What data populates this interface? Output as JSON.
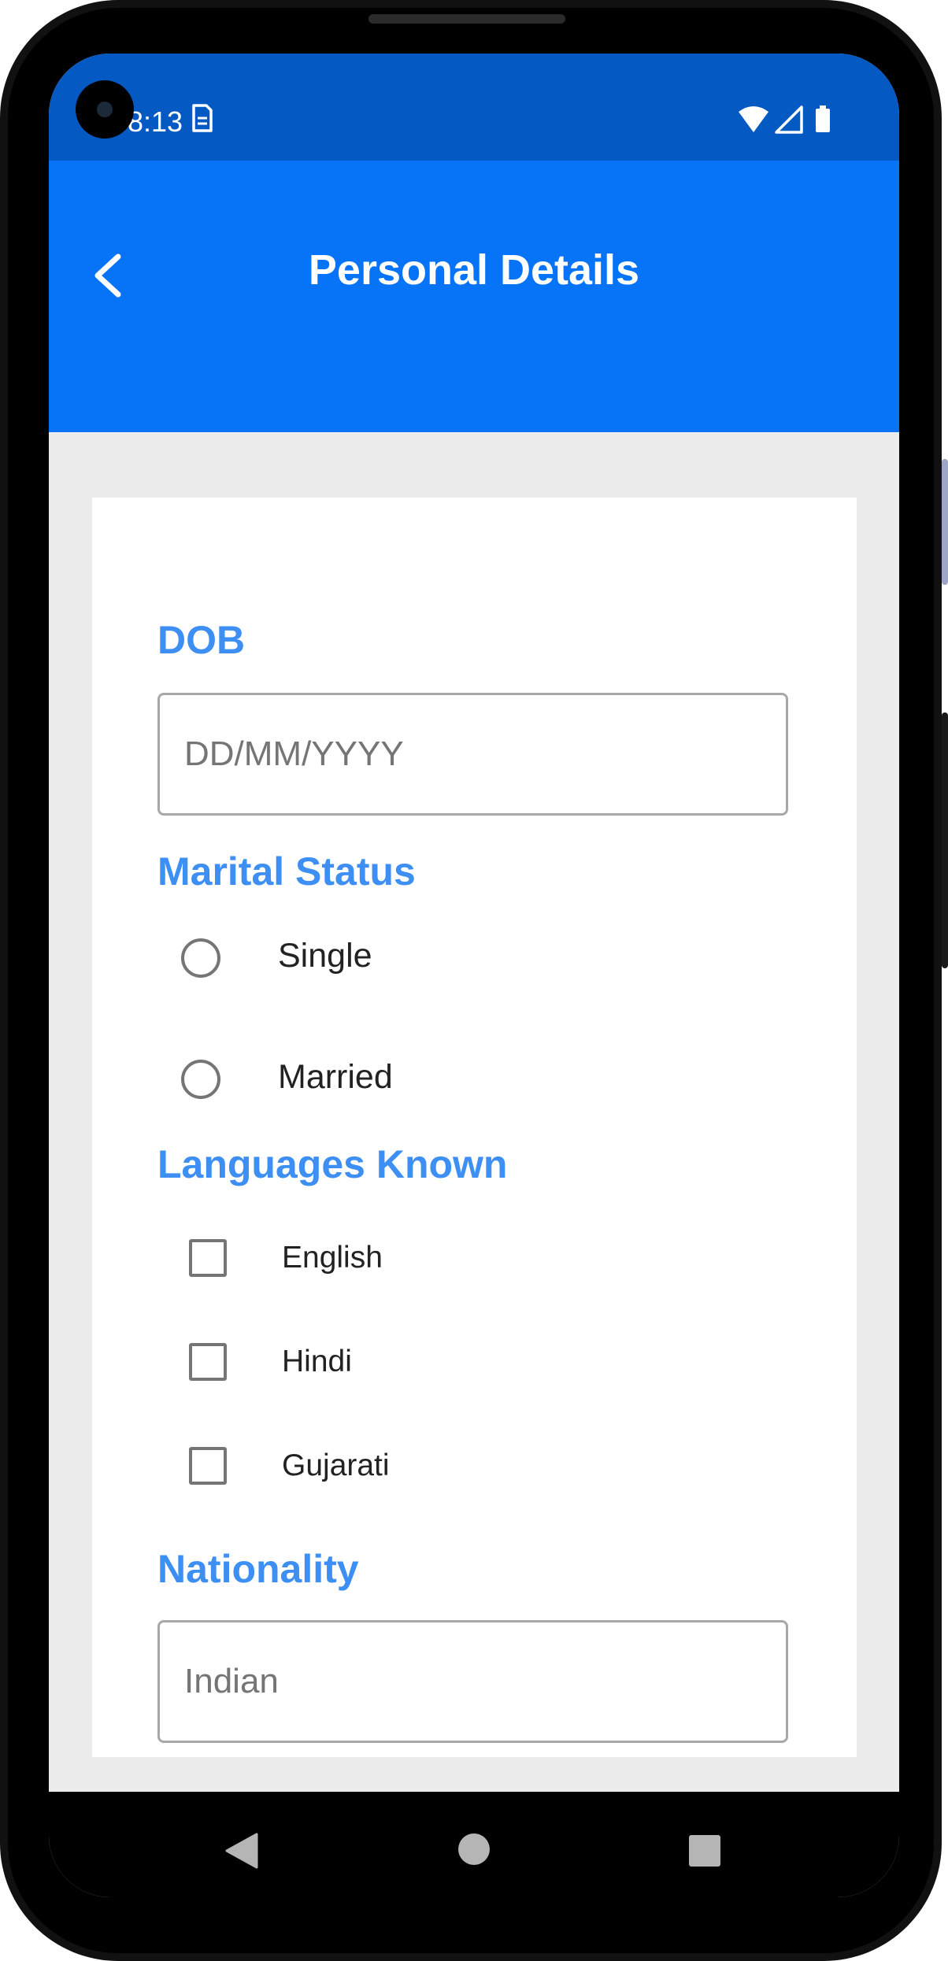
{
  "status_bar": {
    "time": "8:13",
    "icons": [
      "sim-card-icon",
      "wifi-icon",
      "cellular-signal-icon",
      "battery-icon"
    ]
  },
  "app_bar": {
    "title": "Personal Details",
    "back_icon": "chevron-left-icon"
  },
  "form": {
    "dob": {
      "label": "DOB",
      "placeholder": "DD/MM/YYYY",
      "value": ""
    },
    "marital_status": {
      "label": "Marital Status",
      "options": [
        {
          "label": "Single",
          "selected": false
        },
        {
          "label": "Married",
          "selected": false
        }
      ]
    },
    "languages": {
      "label": "Languages Known",
      "options": [
        {
          "label": "English",
          "checked": false
        },
        {
          "label": "Hindi",
          "checked": false
        },
        {
          "label": "Gujarati",
          "checked": false
        }
      ]
    },
    "nationality": {
      "label": "Nationality",
      "placeholder": "Indian",
      "value": ""
    }
  },
  "nav_bar": {
    "buttons": [
      "back-triangle-icon",
      "home-circle-icon",
      "recents-square-icon"
    ]
  },
  "colors": {
    "status_bar": "#0459c2",
    "app_bar": "#0773f7",
    "label_accent": "#3d8ff4",
    "screen_background": "#ececec"
  }
}
